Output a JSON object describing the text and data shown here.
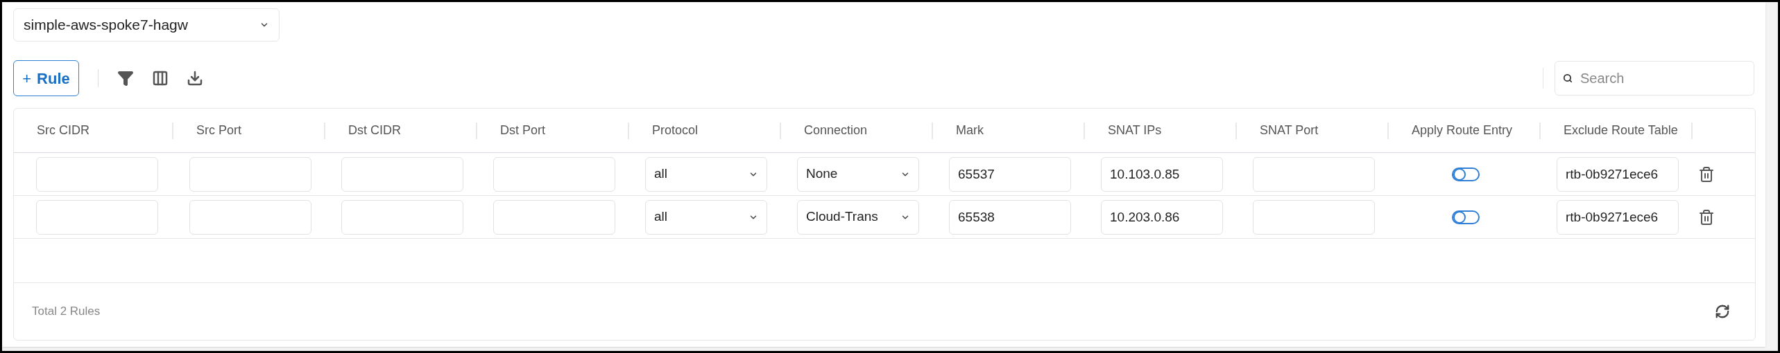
{
  "gateway_select": {
    "value": "simple-aws-spoke7-hagw"
  },
  "toolbar": {
    "add_button": {
      "icon": "+",
      "label": "Rule"
    }
  },
  "search": {
    "placeholder": "Search"
  },
  "table": {
    "columns": [
      "Src CIDR",
      "Src Port",
      "Dst CIDR",
      "Dst Port",
      "Protocol",
      "Connection",
      "Mark",
      "SNAT IPs",
      "SNAT Port",
      "Apply Route Entry",
      "Exclude Route Table"
    ],
    "rows": [
      {
        "cells": [
          {
            "kind": "input"
          },
          {
            "kind": "input"
          },
          {
            "kind": "input"
          },
          {
            "kind": "input"
          },
          {
            "kind": "select",
            "value": "all"
          },
          {
            "kind": "select",
            "value": "None"
          },
          {
            "kind": "input",
            "value": "65537"
          },
          {
            "kind": "input",
            "value": "10.103.0.85"
          },
          {
            "kind": "input"
          },
          {
            "kind": "toggle",
            "on": false
          },
          {
            "kind": "input",
            "value": "rtb-0b9271ece6"
          }
        ]
      },
      {
        "cells": [
          {
            "kind": "input"
          },
          {
            "kind": "input"
          },
          {
            "kind": "input"
          },
          {
            "kind": "input"
          },
          {
            "kind": "select",
            "value": "all"
          },
          {
            "kind": "select",
            "value": "Cloud-Trans"
          },
          {
            "kind": "input",
            "value": "65538"
          },
          {
            "kind": "input",
            "value": "10.203.0.86"
          },
          {
            "kind": "input"
          },
          {
            "kind": "toggle",
            "on": false
          },
          {
            "kind": "input",
            "value": "rtb-0b9271ece6"
          }
        ]
      }
    ]
  },
  "footer": {
    "total": "Total 2 Rules"
  }
}
